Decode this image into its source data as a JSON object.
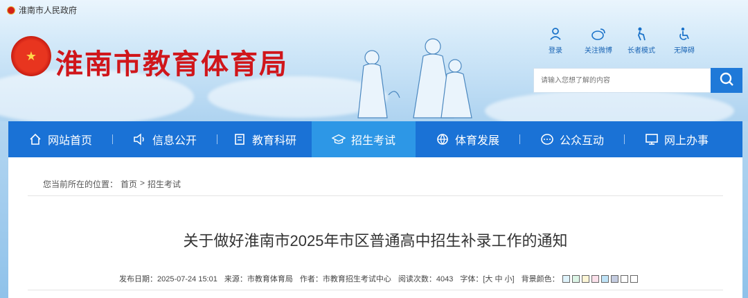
{
  "top_bar": {
    "label": "淮南市人民政府"
  },
  "site": {
    "title": "淮南市教育体育局"
  },
  "tools": [
    {
      "label": "登录",
      "icon": "user-icon"
    },
    {
      "label": "关注微博",
      "icon": "weibo-icon"
    },
    {
      "label": "长者模式",
      "icon": "elder-icon"
    },
    {
      "label": "无障碍",
      "icon": "accessibility-icon"
    }
  ],
  "search": {
    "placeholder": "请输入您想了解的内容"
  },
  "nav": [
    {
      "label": "网站首页",
      "icon": "home-icon"
    },
    {
      "label": "信息公开",
      "icon": "speaker-icon"
    },
    {
      "label": "教育科研",
      "icon": "book-icon"
    },
    {
      "label": "招生考试",
      "icon": "graduation-cap-icon"
    },
    {
      "label": "体育发展",
      "icon": "ball-icon"
    },
    {
      "label": "公众互动",
      "icon": "chat-icon"
    },
    {
      "label": "网上办事",
      "icon": "monitor-icon"
    }
  ],
  "nav_active_index": 3,
  "breadcrumb": {
    "prefix": "您当前所在的位置：",
    "home": "首页",
    "sep": ">",
    "current": "招生考试"
  },
  "article": {
    "title": "关于做好淮南市2025年市区普通高中招生补录工作的通知",
    "meta": {
      "date_label": "发布日期：",
      "date": "2025-07-24 15:01",
      "source_label": "来源：",
      "source": "市教育体育局",
      "author_label": "作者：",
      "author": "市教育招生考试中心",
      "views_label": "阅读次数：",
      "views": "4043",
      "font_label": "字体：",
      "font_open": "[",
      "font_large": "大",
      "font_medium": "中",
      "font_small": "小",
      "font_close": "]",
      "bg_label": "背景颜色："
    },
    "bg_swatches": [
      "#dff3fb",
      "#dcf5e6",
      "#fdf6d6",
      "#fbe0ea",
      "#bfe3f7",
      "#c4cce0",
      "#ffffff",
      "#ffffff"
    ]
  },
  "colors": {
    "brand_red": "#d0161b",
    "nav_blue": "#1a72d6",
    "nav_active": "#2d97e6"
  }
}
